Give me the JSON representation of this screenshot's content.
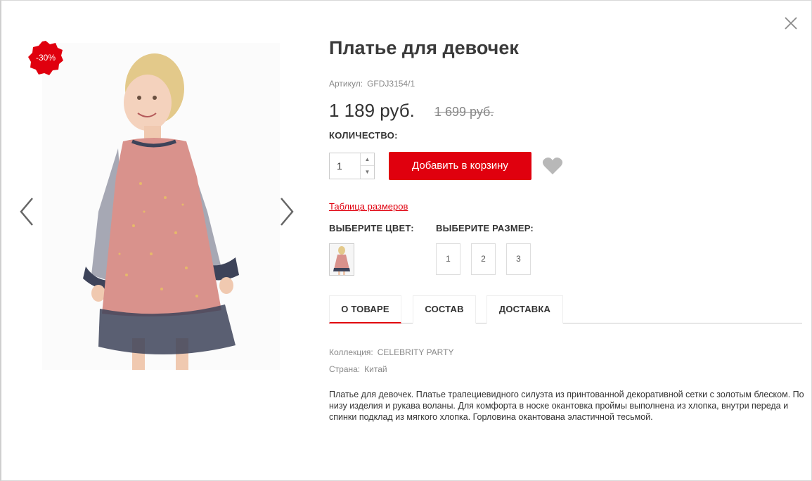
{
  "modal": {
    "close_label": "×"
  },
  "gallery": {
    "discount_badge": "-30%",
    "prev_icon": "chevron-left-icon",
    "next_icon": "chevron-right-icon"
  },
  "product": {
    "title": "Платье для девочек",
    "sku_label": "Артикул:",
    "sku_value": "GFDJ3154/1",
    "price": "1 189 руб.",
    "old_price": "1 699 руб.",
    "quantity_label": "КОЛИЧЕСТВО:",
    "quantity_value": "1",
    "add_to_cart": "Добавить в корзину",
    "favorite_icon": "heart-icon",
    "size_table_link": "Таблица размеров",
    "color_label": "ВЫБЕРИТЕ ЦВЕТ:",
    "size_label": "ВЫБЕРИТЕ РАЗМЕР:",
    "sizes": [
      "1",
      "2",
      "3"
    ]
  },
  "tabs": [
    {
      "label": "О ТОВАРЕ",
      "active": true
    },
    {
      "label": "СОСТАВ",
      "active": false
    },
    {
      "label": "ДОСТАВКА",
      "active": false
    }
  ],
  "details": {
    "collection_label": "Коллекция:",
    "collection_value": "CELEBRITY PARTY",
    "country_label": "Страна:",
    "country_value": "Китай",
    "description": "Платье для девочек. Платье трапециевидного силуэта из принтованной декоративной сетки с золотым блеском. По низу изделия и рукава воланы. Для комфорта в носке окантовка проймы выполнена из хлопка, внутри переда и спинки подклад из мягкого хлопка. Горловина окантована эластичной тесьмой."
  },
  "colors": {
    "accent": "#e0000e",
    "dress_pink": "#d9928c",
    "tulle_navy": "#3d4359"
  }
}
